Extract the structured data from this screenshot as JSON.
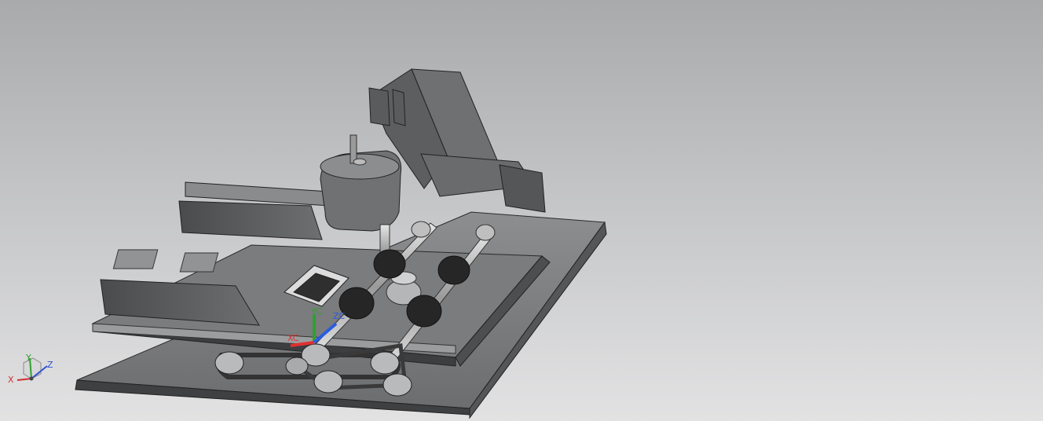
{
  "viewport": {
    "background_top": "#a9aaac",
    "background_bottom": "#e2e2e3"
  },
  "wcs": {
    "xc_label": "XC",
    "yc_label": "YC",
    "zc_label": "ZC",
    "x_color": "#e03030",
    "y_color": "#2fa02f",
    "z_color": "#2a5ce0"
  },
  "view_triad": {
    "x_label": "X",
    "y_label": "Y",
    "z_label": "Z",
    "x_color": "#d03030",
    "y_color": "#30a030",
    "z_color": "#3050d0"
  },
  "model": {
    "icon": "cad-assembly-icon",
    "body_color": "#6b6c6e",
    "edge_color": "#2a2a2a",
    "roller_color": "#262626"
  }
}
